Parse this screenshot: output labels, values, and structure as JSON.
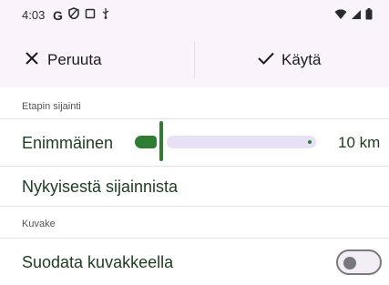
{
  "status_bar": {
    "time": "4:03",
    "icons": [
      "google-icon",
      "vpn-icon",
      "screen-icon",
      "usb-icon",
      "wifi-icon",
      "signal-icon",
      "battery-icon"
    ]
  },
  "action_bar": {
    "cancel_label": "Peruuta",
    "apply_label": "Käytä"
  },
  "section_location": {
    "header": "Etapin sijainti",
    "max_label": "Enimmäinen",
    "slider_value": "10 km",
    "slider_fraction": 0.05,
    "current_location_label": "Nykyisestä sijainnista"
  },
  "section_icon": {
    "header": "Kuvake",
    "filter_label": "Suodata kuvakkeella",
    "toggle_on": false
  },
  "colors": {
    "accent": "#2e7d32",
    "surface": "#fbf3fb",
    "track": "#e7e0f7"
  }
}
